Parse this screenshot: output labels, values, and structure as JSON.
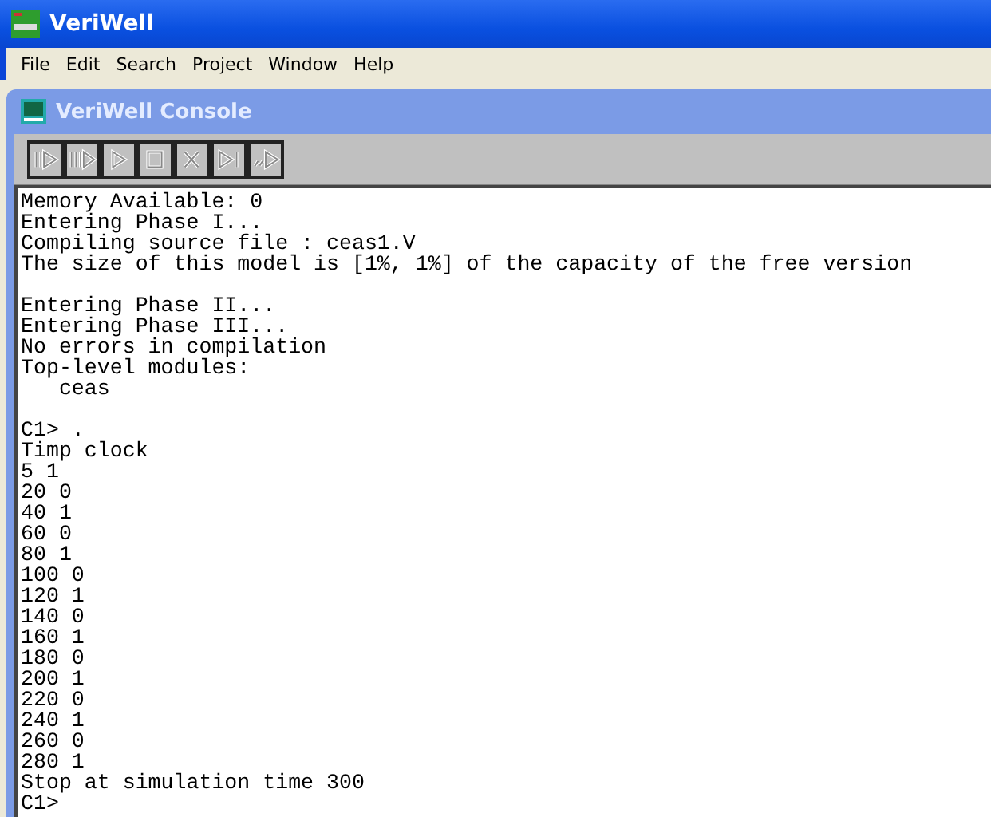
{
  "window": {
    "title": "VeriWell"
  },
  "menu": [
    "File",
    "Edit",
    "Search",
    "Project",
    "Window",
    "Help"
  ],
  "console_window": {
    "title": "VeriWell Console"
  },
  "toolbar": [
    {
      "kind": "run-step"
    },
    {
      "kind": "run-multi"
    },
    {
      "kind": "play"
    },
    {
      "kind": "stop"
    },
    {
      "kind": "cancel"
    },
    {
      "kind": "step-end"
    },
    {
      "kind": "trace"
    }
  ],
  "console_blocks": [
    {
      "lines": [
        "Memory Available: 0",
        "Entering Phase I...",
        "Compiling source file : ceas1.V",
        "The size of this model is [1%, 1%] of the capacity of the free version"
      ]
    },
    {
      "lines": [
        "Entering Phase II...",
        "Entering Phase III...",
        "No errors in compilation",
        "Top-level modules:",
        "   ceas"
      ]
    },
    {
      "lines": [
        "C1> .",
        "Timp clock",
        "5 1",
        "20 0",
        "40 1",
        "60 0",
        "80 1",
        "100 0",
        "120 1",
        "140 0",
        "160 1",
        "180 0",
        "200 1",
        "220 0",
        "240 1",
        "260 0",
        "280 1",
        "Stop at simulation time 300",
        "C1>"
      ]
    }
  ]
}
